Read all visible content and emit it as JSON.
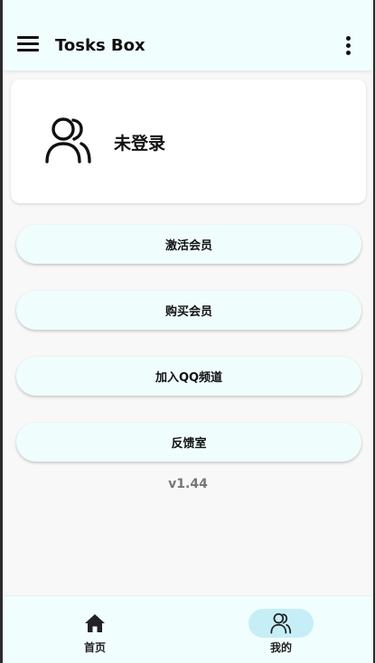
{
  "appbar": {
    "title": "Tosks Box",
    "menu_icon": "menu-icon",
    "more_icon": "more-vert-icon"
  },
  "profile": {
    "icon": "people-icon",
    "status": "未登录"
  },
  "actions": [
    {
      "label": "激活会员"
    },
    {
      "label": "购买会员"
    },
    {
      "label": "加入QQ频道"
    },
    {
      "label": "反馈室"
    }
  ],
  "version": "v1.44",
  "bottom_nav": {
    "items": [
      {
        "label": "首页",
        "icon": "home-icon",
        "active": false
      },
      {
        "label": "我的",
        "icon": "people-icon",
        "active": true
      }
    ]
  },
  "colors": {
    "appbar_bg": "#f1fefe",
    "button_bg": "#effefd",
    "nav_active": "#c6eef7"
  }
}
